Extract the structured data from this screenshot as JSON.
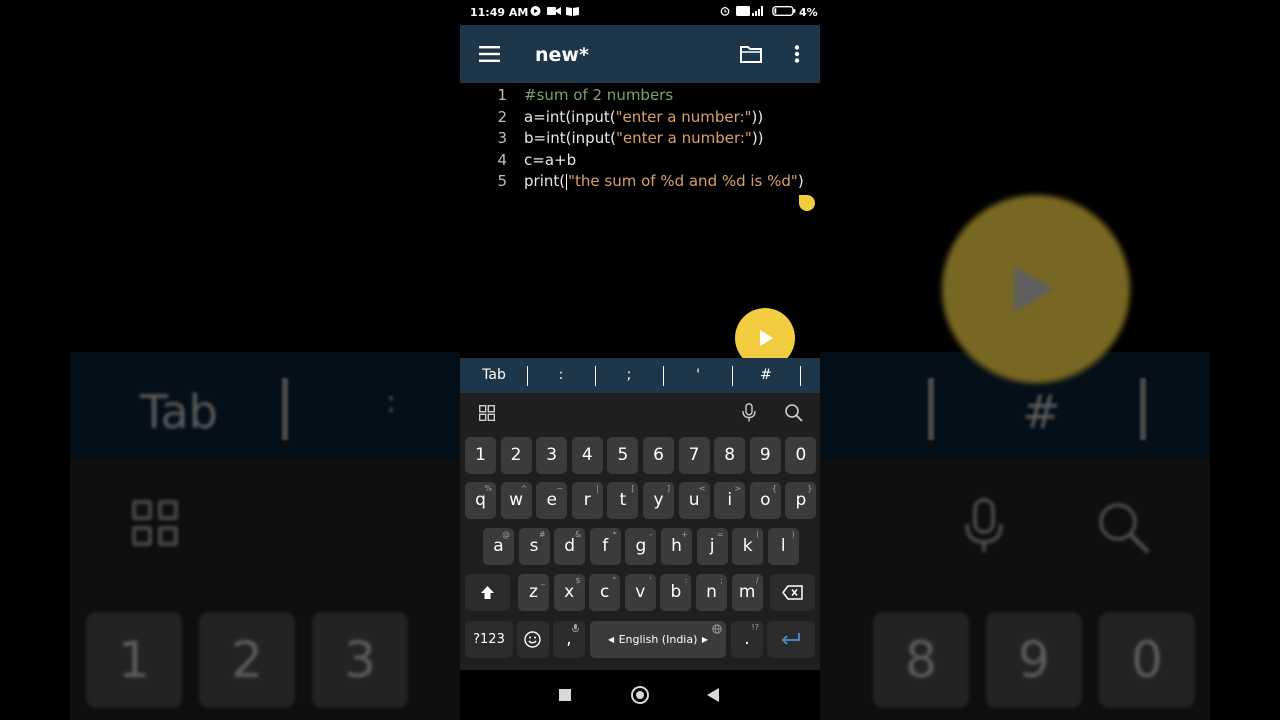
{
  "status_bar": {
    "time": "11:49 AM",
    "battery_percent": "4%",
    "icons": [
      "youtube-icon",
      "video-icon",
      "book-icon",
      "alarm-icon",
      "volte-icon",
      "signal-icon",
      "battery-icon"
    ]
  },
  "app_bar": {
    "title": "new*",
    "icons": [
      "menu-icon",
      "folder-icon",
      "more-vert-icon"
    ],
    "color": "#1d3649"
  },
  "editor": {
    "lines": [
      {
        "num": "1",
        "parts": [
          {
            "t": "#sum of 2 numbers",
            "k": "comment"
          }
        ]
      },
      {
        "num": "2",
        "parts": [
          {
            "t": "a=int(input(",
            "k": "code"
          },
          {
            "t": "\"enter a number:\"",
            "k": "str"
          },
          {
            "t": "))",
            "k": "code"
          }
        ]
      },
      {
        "num": "3",
        "parts": [
          {
            "t": "b=int(input(",
            "k": "code"
          },
          {
            "t": "\"enter a number:\"",
            "k": "str"
          },
          {
            "t": "))",
            "k": "code"
          }
        ]
      },
      {
        "num": "4",
        "parts": [
          {
            "t": "c=a+b",
            "k": "code"
          }
        ]
      },
      {
        "num": "5",
        "parts": [
          {
            "t": "print(",
            "k": "code"
          },
          {
            "t": "\"the sum of %d and %d is %d\"",
            "k": "str"
          },
          {
            "t": ")",
            "k": "code"
          }
        ]
      }
    ],
    "comment_color": "#7aa36a",
    "string_color": "#d8a06c"
  },
  "run_button": {
    "icon": "play-icon",
    "color": "#f2cd3f"
  },
  "extra_keys": [
    "Tab",
    ":",
    ";",
    "'",
    "#"
  ],
  "keyboard": {
    "tools": [
      "apps-grid-icon",
      "mic-icon",
      "search-icon"
    ],
    "number_row": [
      "1",
      "2",
      "3",
      "4",
      "5",
      "6",
      "7",
      "8",
      "9",
      "0"
    ],
    "row1": [
      {
        "k": "q",
        "h": "%"
      },
      {
        "k": "w",
        "h": "^"
      },
      {
        "k": "e",
        "h": "~"
      },
      {
        "k": "r",
        "h": "|"
      },
      {
        "k": "t",
        "h": "["
      },
      {
        "k": "y",
        "h": "]"
      },
      {
        "k": "u",
        "h": "<"
      },
      {
        "k": "i",
        "h": ">"
      },
      {
        "k": "o",
        "h": "{"
      },
      {
        "k": "p",
        "h": "}"
      }
    ],
    "row2": [
      {
        "k": "a",
        "h": "@"
      },
      {
        "k": "s",
        "h": "#"
      },
      {
        "k": "d",
        "h": "&"
      },
      {
        "k": "f",
        "h": "*"
      },
      {
        "k": "g",
        "h": "-"
      },
      {
        "k": "h",
        "h": "+"
      },
      {
        "k": "j",
        "h": "="
      },
      {
        "k": "k",
        "h": "("
      },
      {
        "k": "l",
        "h": ")"
      }
    ],
    "row3": [
      {
        "k": "z",
        "h": "_"
      },
      {
        "k": "x",
        "h": "$"
      },
      {
        "k": "c",
        "h": "\""
      },
      {
        "k": "v",
        "h": "'"
      },
      {
        "k": "b",
        "h": ":"
      },
      {
        "k": "n",
        "h": ";"
      },
      {
        "k": "m",
        "h": "/"
      }
    ],
    "shift_icon": "shift-arrow-icon",
    "backspace_icon": "backspace-icon",
    "symbols_label": "?123",
    "emoji_icon": "emoji-icon",
    "comma_label": ",",
    "space_label": "English (India)",
    "period_label": ".",
    "period_hint": "!?",
    "enter_icon": "enter-icon",
    "enter_color": "#4a90d9"
  },
  "nav_bar": {
    "icons": [
      "recents-square-icon",
      "home-circle-icon",
      "back-triangle-icon"
    ]
  },
  "background_echo": {
    "tab": "Tab",
    "colon": ":",
    "hash": "#",
    "left_keys": [
      "1",
      "2",
      "3"
    ],
    "right_keys": [
      "8",
      "9",
      "0"
    ]
  }
}
